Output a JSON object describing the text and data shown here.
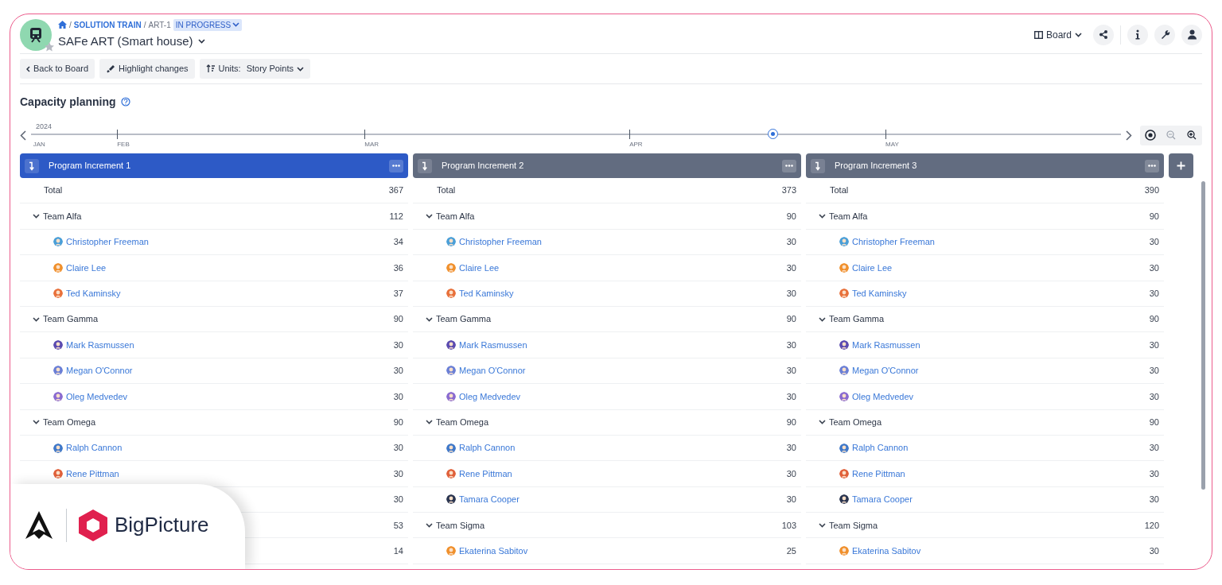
{
  "header": {
    "breadcrumb": [
      {
        "kind": "home"
      },
      {
        "kind": "link",
        "separator": "/",
        "label": "SOLUTION TRAIN"
      },
      {
        "kind": "text",
        "separator": "/",
        "label": "ART-1"
      }
    ],
    "status": "IN PROGRESS",
    "title": "SAFe ART (Smart house)",
    "view": "Board"
  },
  "toolbar": [
    {
      "kind": "back",
      "label": "Back to Board"
    },
    {
      "kind": "highlight",
      "label": "Highlight changes"
    },
    {
      "kind": "units",
      "label": "Units:",
      "value": "Story Points"
    }
  ],
  "section_title": "Capacity planning",
  "timeline": {
    "year": "2024",
    "months": [
      "JAN",
      "FEB",
      "MAR",
      "APR",
      "MAY"
    ]
  },
  "increments": [
    {
      "title": "Program Increment 1",
      "selected": true,
      "rows": [
        {
          "kind": "total",
          "label": "Total",
          "value": "367"
        },
        {
          "kind": "team",
          "label": "Team Alfa",
          "value": "112",
          "expanded": true,
          "children": [
            {
              "kind": "member",
              "label": "Christopher Freeman",
              "value": "34",
              "color": "#4a9fd8"
            },
            {
              "kind": "member",
              "label": "Claire Lee",
              "value": "36",
              "color": "#f0902c"
            },
            {
              "kind": "member",
              "label": "Ted Kaminsky",
              "value": "37",
              "color": "#e8703a"
            }
          ]
        },
        {
          "kind": "team",
          "label": "Team Gamma",
          "value": "90",
          "expanded": true,
          "children": [
            {
              "kind": "member",
              "label": "Mark Rasmussen",
              "value": "30",
              "color": "#5b4bb0"
            },
            {
              "kind": "member",
              "label": "Megan O'Connor",
              "value": "30",
              "color": "#6a7fd6"
            },
            {
              "kind": "member",
              "label": "Oleg Medvedev",
              "value": "30",
              "color": "#8a6bd0"
            }
          ]
        },
        {
          "kind": "team",
          "label": "Team Omega",
          "value": "90",
          "expanded": true,
          "children": [
            {
              "kind": "member",
              "label": "Ralph Cannon",
              "value": "30",
              "color": "#3f78c9"
            },
            {
              "kind": "member",
              "label": "Rene Pittman",
              "value": "30",
              "color": "#e0603a"
            },
            {
              "kind": "member",
              "value": "30"
            }
          ]
        },
        {
          "kind": "team",
          "value": "53",
          "children": [
            {
              "kind": "member",
              "value": "14"
            }
          ]
        }
      ]
    },
    {
      "title": "Program Increment 2",
      "selected": false,
      "rows": [
        {
          "kind": "total",
          "label": "Total",
          "value": "373"
        },
        {
          "kind": "team",
          "label": "Team Alfa",
          "value": "90",
          "expanded": true,
          "children": [
            {
              "kind": "member",
              "label": "Christopher Freeman",
              "value": "30",
              "color": "#4a9fd8"
            },
            {
              "kind": "member",
              "label": "Claire Lee",
              "value": "30",
              "color": "#f0902c"
            },
            {
              "kind": "member",
              "label": "Ted Kaminsky",
              "value": "30",
              "color": "#e8703a"
            }
          ]
        },
        {
          "kind": "team",
          "label": "Team Gamma",
          "value": "90",
          "expanded": true,
          "children": [
            {
              "kind": "member",
              "label": "Mark Rasmussen",
              "value": "30",
              "color": "#5b4bb0"
            },
            {
              "kind": "member",
              "label": "Megan O'Connor",
              "value": "30",
              "color": "#6a7fd6"
            },
            {
              "kind": "member",
              "label": "Oleg Medvedev",
              "value": "30",
              "color": "#8a6bd0"
            }
          ]
        },
        {
          "kind": "team",
          "label": "Team Omega",
          "value": "90",
          "expanded": true,
          "children": [
            {
              "kind": "member",
              "label": "Ralph Cannon",
              "value": "30",
              "color": "#3f78c9"
            },
            {
              "kind": "member",
              "label": "Rene Pittman",
              "value": "30",
              "color": "#e0603a"
            },
            {
              "kind": "member",
              "label": "Tamara Cooper",
              "value": "30",
              "color": "#2a3550"
            }
          ]
        },
        {
          "kind": "team",
          "label": "Team Sigma",
          "value": "103",
          "expanded": true,
          "children": [
            {
              "kind": "member",
              "label": "Ekaterina Sabitov",
              "value": "25",
              "color": "#f0902c"
            }
          ]
        }
      ]
    },
    {
      "title": "Program Increment 3",
      "selected": false,
      "rows": [
        {
          "kind": "total",
          "label": "Total",
          "value": "390"
        },
        {
          "kind": "team",
          "label": "Team Alfa",
          "value": "90",
          "expanded": true,
          "children": [
            {
              "kind": "member",
              "label": "Christopher Freeman",
              "value": "30",
              "color": "#4a9fd8"
            },
            {
              "kind": "member",
              "label": "Claire Lee",
              "value": "30",
              "color": "#f0902c"
            },
            {
              "kind": "member",
              "label": "Ted Kaminsky",
              "value": "30",
              "color": "#e8703a"
            }
          ]
        },
        {
          "kind": "team",
          "label": "Team Gamma",
          "value": "90",
          "expanded": true,
          "children": [
            {
              "kind": "member",
              "label": "Mark Rasmussen",
              "value": "30",
              "color": "#5b4bb0"
            },
            {
              "kind": "member",
              "label": "Megan O'Connor",
              "value": "30",
              "color": "#6a7fd6"
            },
            {
              "kind": "member",
              "label": "Oleg Medvedev",
              "value": "30",
              "color": "#8a6bd0"
            }
          ]
        },
        {
          "kind": "team",
          "label": "Team Omega",
          "value": "90",
          "expanded": true,
          "children": [
            {
              "kind": "member",
              "label": "Ralph Cannon",
              "value": "30",
              "color": "#3f78c9"
            },
            {
              "kind": "member",
              "label": "Rene Pittman",
              "value": "30",
              "color": "#e0603a"
            },
            {
              "kind": "member",
              "label": "Tamara Cooper",
              "value": "30",
              "color": "#2a3550"
            }
          ]
        },
        {
          "kind": "team",
          "label": "Team Sigma",
          "value": "120",
          "expanded": true,
          "children": [
            {
              "kind": "member",
              "label": "Ekaterina Sabitov",
              "value": "30",
              "color": "#f0902c"
            }
          ]
        }
      ]
    }
  ],
  "brand_card": {
    "name": "BigPicture"
  }
}
